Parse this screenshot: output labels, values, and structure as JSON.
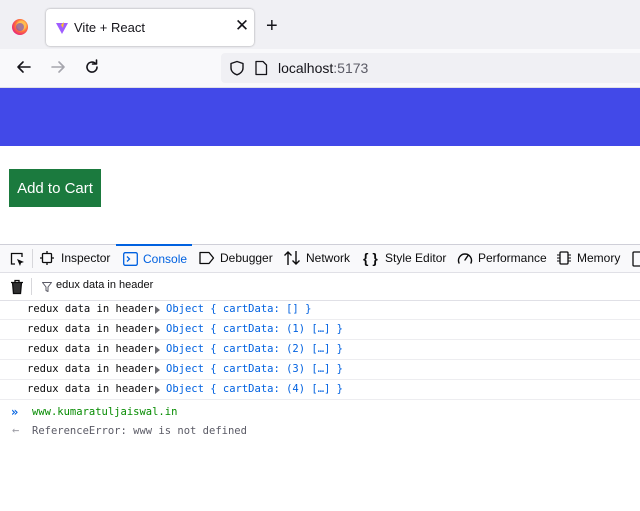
{
  "browser": {
    "tab": {
      "title": "Vite + React"
    },
    "new_tab_symbol": "+",
    "close_symbol": "✕",
    "url": {
      "host": "localhost",
      "port": ":5173"
    }
  },
  "page": {
    "header_color": "#4249e8",
    "add_to_cart": {
      "label": "Add to Cart",
      "color": "#1b7a3e"
    }
  },
  "devtools": {
    "tabs": [
      {
        "label": "Inspector",
        "icon": "inspector-icon"
      },
      {
        "label": "Console",
        "icon": "console-icon",
        "selected": true
      },
      {
        "label": "Debugger",
        "icon": "debugger-icon"
      },
      {
        "label": "Network",
        "icon": "network-icon"
      },
      {
        "label": "Style Editor",
        "icon": "style-editor-icon"
      },
      {
        "label": "Performance",
        "icon": "performance-icon"
      },
      {
        "label": "Memory",
        "icon": "memory-icon"
      }
    ],
    "filter_value": "edux data in header",
    "logs": [
      {
        "message": "redux data in header",
        "object": "Object { cartData: [] }"
      },
      {
        "message": "redux data in header",
        "object": "Object { cartData: (1) […] }"
      },
      {
        "message": "redux data in header",
        "object": "Object { cartData: (2) […] }"
      },
      {
        "message": "redux data in header",
        "object": "Object { cartData: (3) […] }"
      },
      {
        "message": "redux data in header",
        "object": "Object { cartData: (4) […] }"
      }
    ],
    "command": {
      "prompt": "»",
      "text": "www.kumaratuljaiswal.in"
    },
    "error": {
      "arrow": "←",
      "text": "ReferenceError: www is not defined"
    }
  }
}
